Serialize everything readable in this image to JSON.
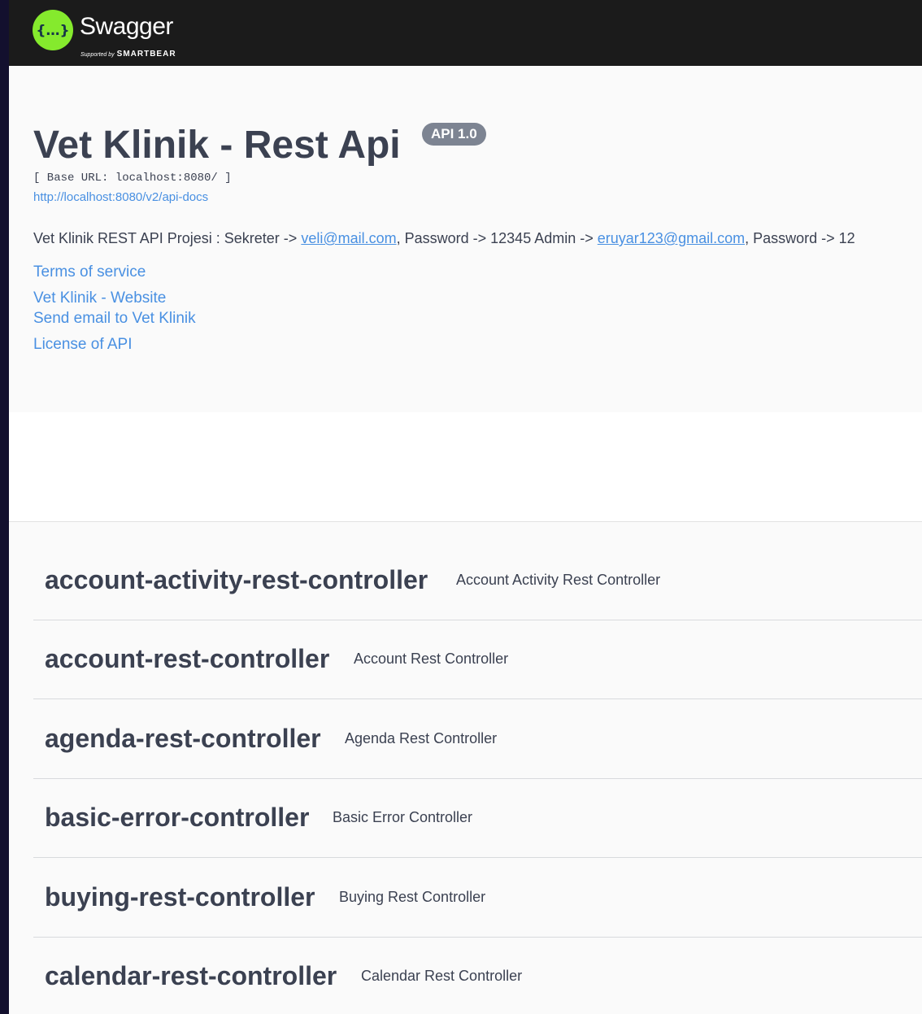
{
  "topbar": {
    "logo_word": "Swagger",
    "logo_supported_by": "Supported by",
    "logo_brand": "SMARTBEAR",
    "logo_glyph": "{…}",
    "logo_color": "#85ea2d",
    "icon": "swagger-logo-icon"
  },
  "info": {
    "title": "Vet Klinik - Rest Api",
    "version": "API 1.0",
    "base_url": "[ Base URL: localhost:8080/ ]",
    "docs_url": "http://localhost:8080/v2/api-docs",
    "description": {
      "part1": "Vet Klinik REST API Projesi : Sekreter -> ",
      "email1": "veli@mail.com",
      "part2": ", Password -> 12345 Admin -> ",
      "email2": "eruyar123@gmail.com",
      "part3": ", Password -> 12"
    },
    "links": {
      "terms": "Terms of service",
      "website": "Vet Klinik - Website",
      "email": "Send email to Vet Klinik",
      "license": "License of API"
    },
    "link_color": "#4990e2"
  },
  "tags": [
    {
      "name": "account-activity-rest-controller",
      "description": "Account Activity Rest Controller"
    },
    {
      "name": "account-rest-controller",
      "description": "Account Rest Controller"
    },
    {
      "name": "agenda-rest-controller",
      "description": "Agenda Rest Controller"
    },
    {
      "name": "basic-error-controller",
      "description": "Basic Error Controller"
    },
    {
      "name": "buying-rest-controller",
      "description": "Buying Rest Controller"
    },
    {
      "name": "calendar-rest-controller",
      "description": "Calendar Rest Controller"
    }
  ]
}
